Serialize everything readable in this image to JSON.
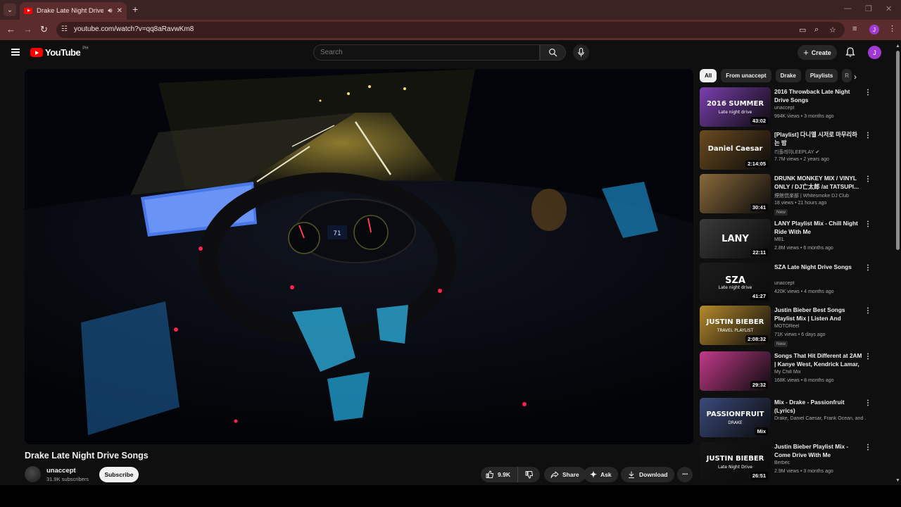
{
  "browser": {
    "tab_title": "Drake Late Night Drive Songs",
    "url": "youtube.com/watch?v=qq8aRavwKm8",
    "profile_initial": "J"
  },
  "masthead": {
    "logo_text": "YouTube",
    "region": "PH",
    "search_placeholder": "Search",
    "create_label": "Create",
    "avatar_initial": "J"
  },
  "video": {
    "title": "Drake Late Night Drive Songs",
    "channel": "unaccept",
    "subscribers": "31.9K subscribers",
    "subscribe_label": "Subscribe",
    "dashboard_speed": "71",
    "actions": {
      "likes": "9.9K",
      "share": "Share",
      "ask": "Ask",
      "download": "Download"
    }
  },
  "chips": [
    {
      "label": "All",
      "active": true
    },
    {
      "label": "From unaccept"
    },
    {
      "label": "Drake"
    },
    {
      "label": "Playlists"
    },
    {
      "label": "R"
    }
  ],
  "recommendations": [
    {
      "title": "2016 Throwback Late Night Drive Songs",
      "channel": "unaccept",
      "views": "994K views",
      "age": "3 months ago",
      "duration": "43:02",
      "thumb_text": "2016 SUMMER",
      "thumb_sub": "Late night drive",
      "thumb_color": "#7a3fae"
    },
    {
      "title": "[Playlist] 다니엘 시저로 마무리하는 밤",
      "channel": "리플레이LEEPLAY",
      "verified": true,
      "views": "7.7M views",
      "age": "2 years ago",
      "duration": "2:14:05",
      "thumb_text": "Daniel Caesar",
      "thumb_color": "#6b4a1f"
    },
    {
      "title": "DRUNK MONKEY MIX / VINYL ONLY / DJ亡太郎 /at TATSUPI...",
      "channel": "煙館倶楽部 | Whitesmoke DJ Club",
      "views": "18 views",
      "age": "21 hours ago",
      "badge": "New",
      "duration": "30:41",
      "thumb_color": "#8a6a3a"
    },
    {
      "title": "LANY Playlist Mix - Chill Night Ride With Me",
      "channel": "MEL",
      "views": "2.8M views",
      "age": "6 months ago",
      "duration": "22:11",
      "thumb_text": "LANY",
      "thumb_color": "#3a3a3a"
    },
    {
      "title": "SZA Late Night Drive Songs",
      "channel": "unaccept",
      "views": "420K views",
      "age": "4 months ago",
      "duration": "41:27",
      "thumb_text": "SZA",
      "thumb_sub": "Late night drive",
      "thumb_color": "#1c1c1c"
    },
    {
      "title": "Justin Bieber Best Songs Playlist Mix | Listen And Travel...",
      "channel": "MOTOReel",
      "views": "71K views",
      "age": "6 days ago",
      "badge": "New",
      "duration": "2:08:32",
      "thumb_text": "JUSTIN BIEBER",
      "thumb_sub": "TRAVEL PLAYLIST",
      "thumb_color": "#b58a2c"
    },
    {
      "title": "Songs That Hit Different at 2AM | Kanye West, Kendrick Lamar, ...",
      "channel": "My Chill Mix",
      "views": "168K views",
      "age": "8 months ago",
      "duration": "29:32",
      "thumb_color": "#c23a8a"
    },
    {
      "title": "Mix - Drake - Passionfruit (Lyrics)",
      "channel": "Drake, Daniel Caesar, Frank Ocean, and ...",
      "duration": "Mix",
      "thumb_text": "PASSIONFRUIT",
      "thumb_sub": "DRAKE",
      "thumb_color": "#3a4a7a"
    },
    {
      "title": "Justin Bieber Playlist Mix - Come Drive With Me",
      "channel": "Berbec",
      "views": "2.9M views",
      "age": "3 months ago",
      "duration": "26:51",
      "thumb_text": "JUSTIN BIEBER",
      "thumb_sub": "Late Night Drive",
      "thumb_color": "#141414"
    }
  ]
}
